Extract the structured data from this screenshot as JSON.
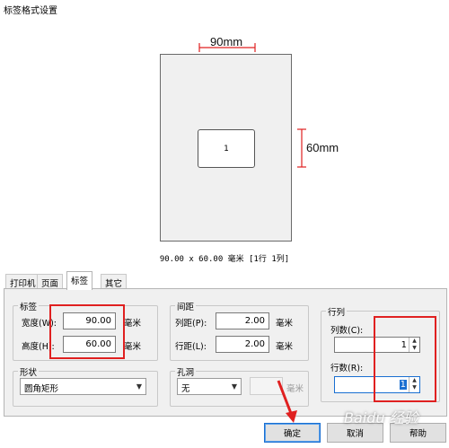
{
  "window": {
    "title": "标签格式设置"
  },
  "preview": {
    "width_label": "90mm",
    "height_label": "60mm",
    "label_number": "1",
    "summary": "90.00 x 60.00 毫米 [1行 1列]"
  },
  "tabs": [
    {
      "label": "打印机",
      "active": false
    },
    {
      "label": "页面",
      "active": false
    },
    {
      "label": "标签",
      "active": true
    },
    {
      "label": "其它",
      "active": false
    }
  ],
  "label_group": {
    "title": "标签",
    "width_label": "宽度(W):",
    "width_value": "90.00",
    "width_unit": "毫米",
    "height_label": "高度(H):",
    "height_value": "60.00",
    "height_unit": "毫米"
  },
  "spacing_group": {
    "title": "间距",
    "col_label": "列距(P):",
    "col_value": "2.00",
    "col_unit": "毫米",
    "row_label": "行距(L):",
    "row_value": "2.00",
    "row_unit": "毫米"
  },
  "rowcol_group": {
    "title": "行列",
    "cols_label": "列数(C):",
    "cols_value": "1",
    "rows_label": "行数(R):",
    "rows_value": "1"
  },
  "shape_group": {
    "title": "形状",
    "value": "圆角矩形"
  },
  "hole_group": {
    "title": "孔洞",
    "value": "无",
    "unit": "毫米"
  },
  "buttons": {
    "ok": "确定",
    "cancel": "取消",
    "help": "帮助"
  },
  "watermark": "Baidu 经验",
  "colors": {
    "highlight": "#e02020",
    "focus": "#1a6fd1"
  }
}
